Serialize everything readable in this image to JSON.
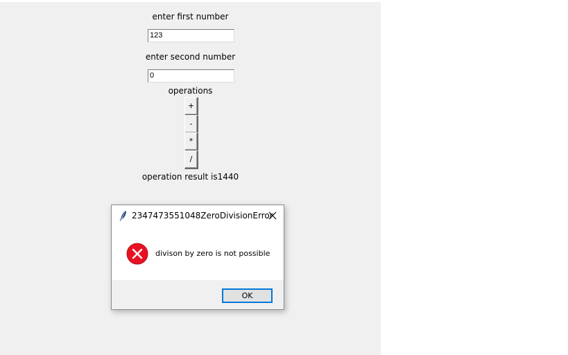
{
  "calculator": {
    "first_label": "enter first number",
    "first_value": "123",
    "second_label": "enter second number",
    "second_value": "0",
    "operations_label": "operations",
    "operations": [
      "+",
      "-",
      "*",
      "/"
    ],
    "result_text": "operation result is1440"
  },
  "dialog": {
    "title": "2347473551048ZeroDivisionError",
    "title_icon": "feather-icon",
    "close_icon": "close-icon",
    "error_icon": "error-icon",
    "message": "divison by zero is not possible",
    "ok_label": "OK",
    "colors": {
      "error_red": "#e81123",
      "accent_blue": "#0078d7"
    }
  }
}
